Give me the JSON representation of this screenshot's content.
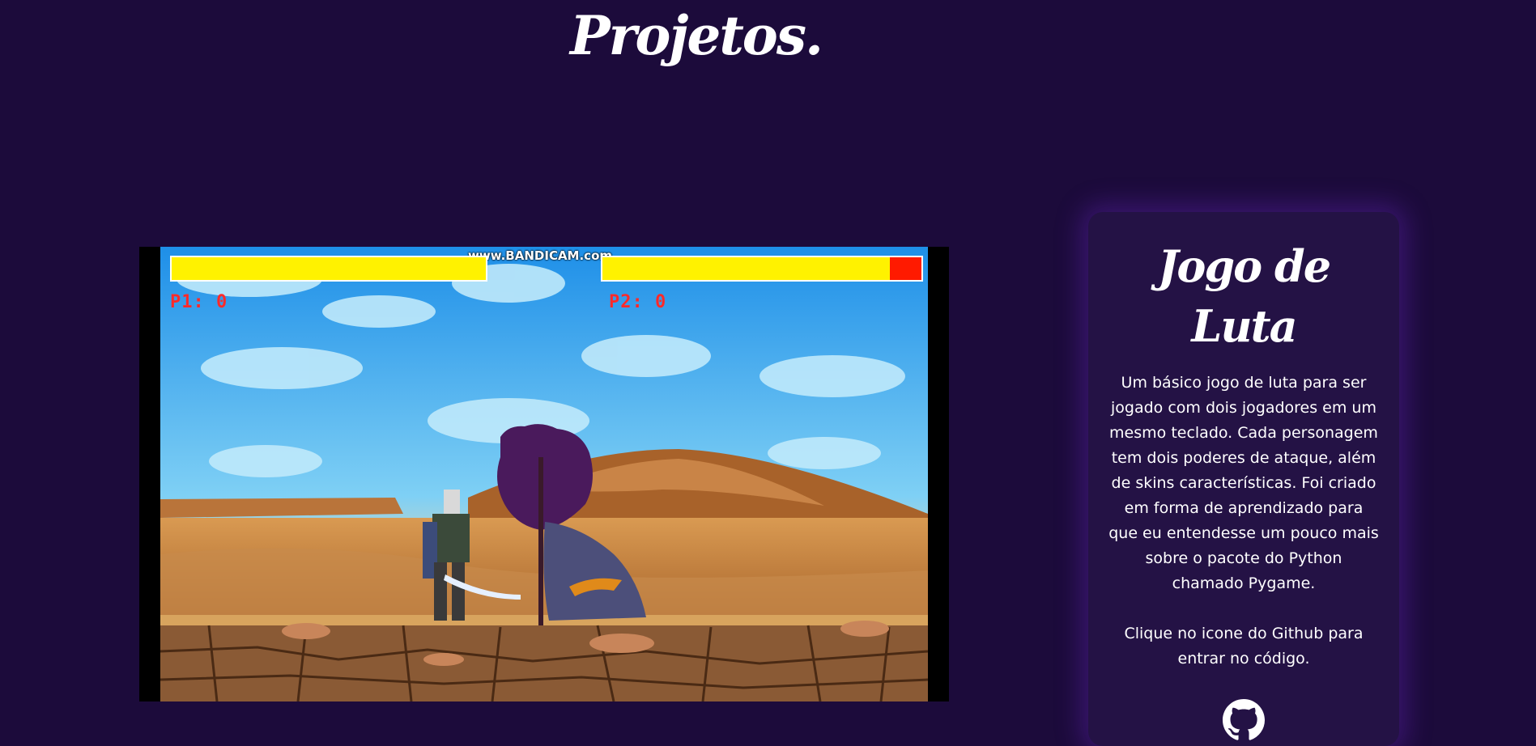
{
  "page": {
    "title": "Projetos."
  },
  "video": {
    "watermark": "www.BANDICAM.com",
    "player1": {
      "score_label": "P1: 0",
      "health_fraction": 1.0
    },
    "player2": {
      "score_label": "P2: 0",
      "health_fraction": 0.9
    }
  },
  "project": {
    "title": "Jogo de Luta",
    "description": "Um básico jogo de luta para ser jogado com dois jogadores em um mesmo teclado. Cada personagem tem dois poderes de ataque, além de skins características. Foi criado em forma de aprendizado para que eu entendesse um pouco mais sobre o pacote do Python chamado Pygame.",
    "cta": "Clique no icone do Github para entrar no código.",
    "link_icon": "github-icon"
  },
  "colors": {
    "background": "#1c0b3b",
    "card": "#241245",
    "health": "#fff200",
    "health_lost": "#ff1a00",
    "score_text": "#ff2a2a"
  }
}
